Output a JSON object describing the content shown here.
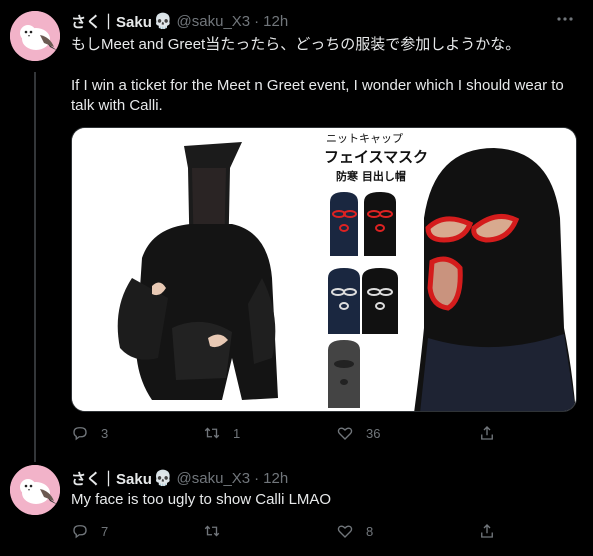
{
  "tweets": [
    {
      "display_name": "さく｜Saku",
      "handle": "@saku_X3",
      "separator": "·",
      "time": "12h",
      "text_jp": "もしMeet and Greet当たったら、どっちの服装で参加しようかな。",
      "text_en": "If I win a ticket for the Meet n Greet event, I wonder which I should wear to talk with Calli.",
      "media_text": {
        "line1": "ニットキャップ",
        "line2": "フェイスマスク",
        "line3": "防寒 目出し帽"
      },
      "replies": "3",
      "retweets": "1",
      "likes": "36"
    },
    {
      "display_name": "さく｜Saku",
      "handle": "@saku_X3",
      "separator": "·",
      "time": "12h",
      "text": "My face is too ugly to show Calli LMAO",
      "replies": "7",
      "retweets": "",
      "likes": "8"
    }
  ],
  "icons": {
    "name_emoji": "skull-icon",
    "more": "more-icon",
    "reply": "reply-icon",
    "retweet": "retweet-icon",
    "like": "heart-icon",
    "share": "share-icon"
  },
  "colors": {
    "background": "#000000",
    "text": "#e7e9ea",
    "muted": "#71767b",
    "avatar_bg": "#f2b3c9",
    "thread_line": "#333639"
  }
}
